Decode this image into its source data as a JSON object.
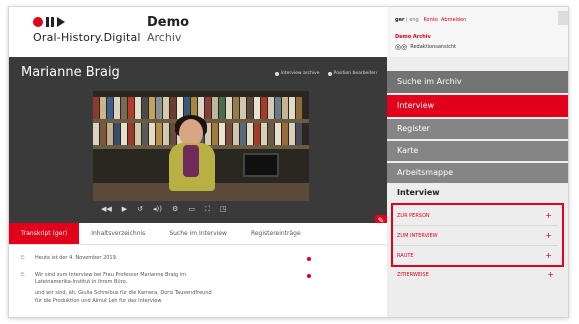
{
  "header": {
    "logo_text": "Oral-History.Digital",
    "site_title": "Demo",
    "site_subtitle": "Archiv"
  },
  "main": {
    "interviewee_name": "Marianne Braig",
    "video_badges": [
      "Interview archive",
      "Position bearbeiten"
    ]
  },
  "tabs": [
    {
      "label": "Transkript (ger)",
      "active": true
    },
    {
      "label": "Inhaltsverzeichnis",
      "active": false
    },
    {
      "label": "Suche im Interview",
      "active": false
    },
    {
      "label": "Registereinträge",
      "active": false
    }
  ],
  "transcript": [
    {
      "ts": "E:",
      "text": "Heute ist der 4. November 2019."
    },
    {
      "ts": "E:",
      "text": "Wir sind zum Interview bei Frau Professor Marianne Braig im"
    },
    {
      "ts": "",
      "text": "Lateinamerika-Institut in ihrem Büro,"
    },
    {
      "ts": "",
      "text": "und wir sind, äh, Giulia Schreibus für die Kamera, Doris Tausendfreund"
    },
    {
      "ts": "",
      "text": "für die Produktion und Almut Leh für das Interview"
    }
  ],
  "sidebar": {
    "lang_current": "ger",
    "lang_other": "eng",
    "account_link": "Konto",
    "logout_link": "Abmelden",
    "archive_label": "Demo Archiv",
    "edit_view_label": "Redaktionsansicht",
    "nav": {
      "search": "Suche im Archiv",
      "interview": "Interview",
      "register": "Register",
      "map": "Karte",
      "workbook": "Arbeitsmappe",
      "section_interview": "Interview"
    },
    "sub_items": [
      "ZUR PERSON",
      "ZUM INTERVIEW",
      "RAUTE"
    ],
    "extra_item": "ZITIERWEISE"
  },
  "colors": {
    "accent": "#e2001a",
    "dark_bg": "#3a3a3a",
    "nav_gray": "#737373"
  }
}
